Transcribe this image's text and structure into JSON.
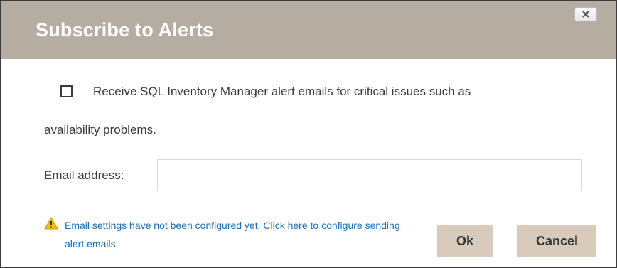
{
  "dialog": {
    "title": "Subscribe to Alerts",
    "close_icon": "close-icon",
    "description_line1": "Receive SQL Inventory Manager alert emails for critical issues such as",
    "description_line2": "availability problems.",
    "checkbox_checked": false,
    "email_label": "Email address:",
    "email_value": "",
    "email_placeholder": "",
    "warning_icon": "warning-icon",
    "warning_text": "Email settings have not been configured yet. Click here to configure sending alert emails.",
    "ok_label": "Ok",
    "cancel_label": "Cancel"
  },
  "colors": {
    "titlebar": "#b6ada2",
    "button": "#d8cbbb",
    "link": "#1a6fb5",
    "warning": "#f2c200"
  }
}
